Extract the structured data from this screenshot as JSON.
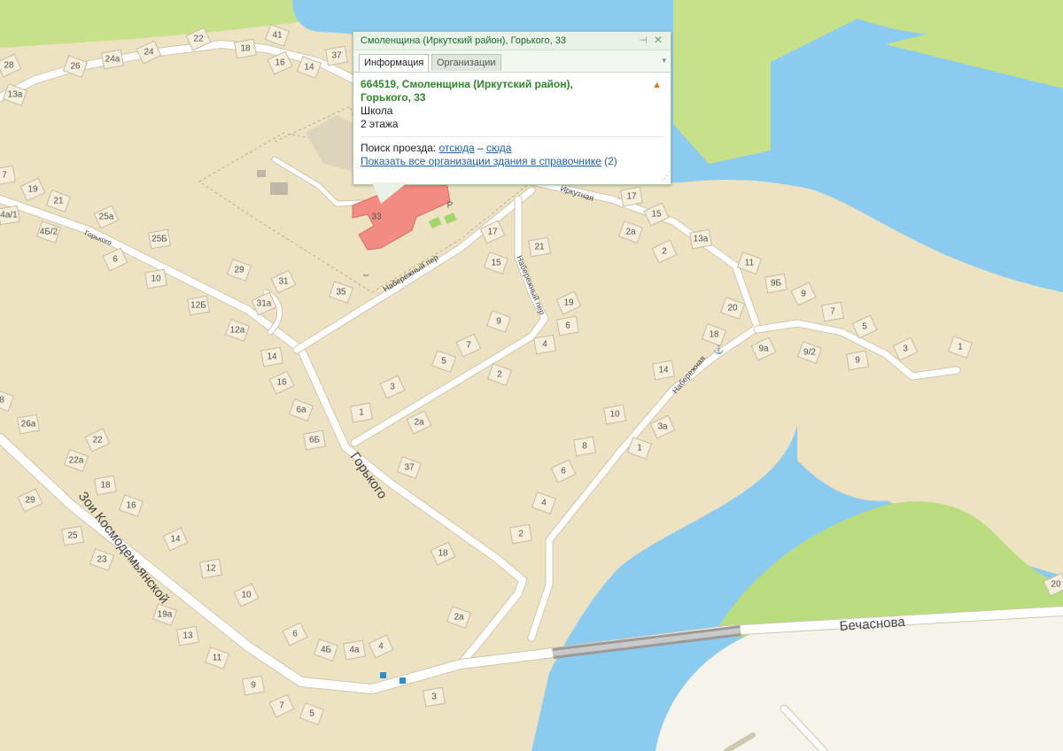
{
  "popup": {
    "title": "Смоленщина (Иркутский район), Горького, 33",
    "pin_icon": "pin-icon",
    "close_icon": "close-icon",
    "tabs": [
      {
        "label": "Информация",
        "active": true
      },
      {
        "label": "Организации",
        "active": false
      }
    ],
    "address_line1": "664519, Смоленщина (Иркутский район),",
    "address_line2": "Горького, 33",
    "type": "Школа",
    "floors": "2 этажа",
    "route_label": "Поиск проезда:",
    "route_from": "отсюда",
    "route_dash": "–",
    "route_to": "сюда",
    "orgs_link": "Показать все организации здания в справочнике",
    "orgs_count": "(2)"
  },
  "map": {
    "colors": {
      "land": "#ede2c2",
      "water": "#8ccbf0",
      "park": "#c7e08a",
      "road": "#ffffff",
      "selected_building": "#f28b82",
      "building": "#f4eeda"
    },
    "selected_building_number": "33",
    "parking_label": "P",
    "streets": [
      {
        "name": "Горького",
        "size": "large"
      },
      {
        "name": "Зои Космодемьянской",
        "size": "large"
      },
      {
        "name": "Бечаснова",
        "size": "large"
      },
      {
        "name": "Набережный пер",
        "size": "small"
      },
      {
        "name": "Набережная",
        "size": "small"
      },
      {
        "name": "Иркутная",
        "size": "small"
      },
      {
        "name": "Горького",
        "size": "small"
      }
    ],
    "house_numbers": [
      "22",
      "41",
      "18",
      "16",
      "14",
      "37",
      "28",
      "26",
      "24а",
      "24",
      "13а",
      "7",
      "19",
      "21",
      "4а/1",
      "25а",
      "4Б/2",
      "25Б",
      "6",
      "29",
      "10",
      "31",
      "35",
      "12Б",
      "31а",
      "12а",
      "14",
      "16",
      "6а",
      "6Б",
      "17",
      "15",
      "21",
      "19",
      "9",
      "6",
      "7",
      "5",
      "4",
      "3",
      "2",
      "1",
      "2а",
      "37",
      "17",
      "15",
      "2а",
      "13а",
      "2",
      "11",
      "9Б",
      "9",
      "20",
      "7",
      "5",
      "18",
      "14",
      "9а",
      "9/2",
      "9",
      "3",
      "1",
      "10",
      "3а",
      "1",
      "8",
      "6",
      "4",
      "2",
      "18",
      "2а",
      "26а",
      "22",
      "22а",
      "18",
      "29",
      "16",
      "25",
      "14",
      "23",
      "12",
      "10",
      "19а",
      "13",
      "6",
      "4Б",
      "4а",
      "4",
      "11",
      "9",
      "7",
      "5",
      "3",
      "20",
      "8"
    ]
  }
}
